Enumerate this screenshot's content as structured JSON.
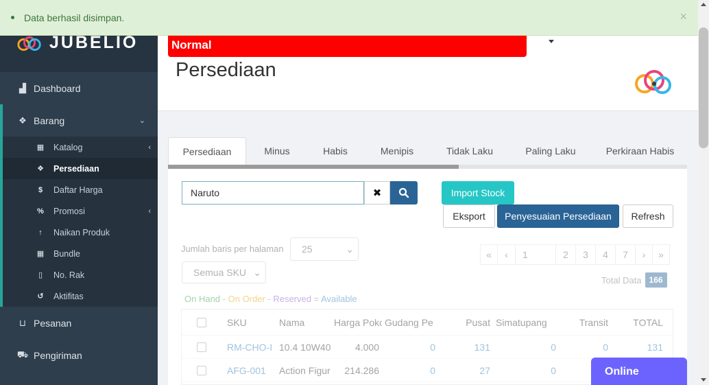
{
  "alert": {
    "message": "Data berhasil disimpan.",
    "close": "×"
  },
  "brand": {
    "name": "JUBELIO"
  },
  "sidebar": {
    "dashboard": "Dashboard",
    "barang": "Barang",
    "sub": {
      "katalog": "Katalog",
      "persediaan": "Persediaan",
      "daftar_harga": "Daftar Harga",
      "promosi": "Promosi",
      "naikan_produk": "Naikan Produk",
      "bundle": "Bundle",
      "no_rak": "No. Rak",
      "aktifitas": "Aktifitas"
    },
    "pesanan": "Pesanan",
    "pengiriman": "Pengiriman"
  },
  "header": {
    "status": "Normal",
    "title": "Persediaan"
  },
  "tabs": [
    "Persediaan",
    "Minus",
    "Habis",
    "Menipis",
    "Tidak Laku",
    "Paling Laku",
    "Perkiraan Habis"
  ],
  "toolbar": {
    "search_value": "Naruto",
    "import": "Import Stock",
    "export": "Eksport",
    "adjust": "Penyesuaian Persediaan",
    "refresh": "Refresh"
  },
  "list": {
    "rows_label": "Jumlah baris per halaman",
    "rows_value": "25",
    "sku_filter": "Semua SKU",
    "pager": [
      "«",
      "‹",
      "1",
      "2",
      "3",
      "4",
      "7",
      "›",
      "»"
    ],
    "total_label": "Total Data",
    "total_value": "166",
    "legend": {
      "on_hand": "On Hand",
      "minus1": " - ",
      "on_order": "On Order",
      "minus2": " - ",
      "reserved": "Reserved",
      "eq": " = ",
      "available": "Available"
    }
  },
  "table": {
    "headers": [
      "SKU",
      "Nama",
      "Harga Poko",
      "Gudang Pe",
      "Pusat",
      "Simatupang",
      "Transit",
      "TOTAL"
    ],
    "rows": [
      [
        "RM-CHO-I",
        "10.4 10W40",
        "4.000",
        "0",
        "131",
        "0",
        "0",
        "131"
      ],
      [
        "AFG-001",
        "Action Figur",
        "214.286",
        "0",
        "27",
        "0",
        "",
        ""
      ]
    ]
  },
  "chat": {
    "label": "Online"
  },
  "colors": {
    "status": "#ff0000",
    "primary": "#2a6496",
    "accent": "#26a69a",
    "import": "#26c6c6",
    "chat": "#6c63ff"
  }
}
